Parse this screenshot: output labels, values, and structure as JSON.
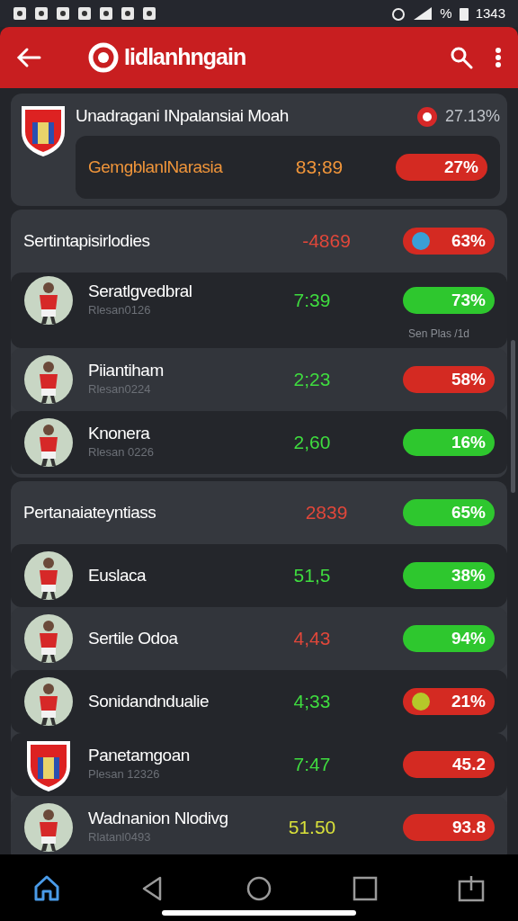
{
  "status_bar": {
    "battery_text": "%",
    "time": "1343"
  },
  "app_bar": {
    "title": "Iidlanhngain"
  },
  "match": {
    "title": "Unadragani INpalansiai Moah",
    "percent": "27.13%",
    "row": {
      "name": "GemgblanlNarasia",
      "value": "83;89",
      "color": "#f0953a",
      "pill": {
        "text": "27%",
        "color": "#d42a22"
      }
    }
  },
  "rows": [
    {
      "kind": "section",
      "name": "Sertintapisirlodies",
      "value": "-4869",
      "color": "#e0473a",
      "pill": {
        "text": "63%",
        "color": "#d42a22",
        "dot": {
          "color": "#3a9fd6"
        }
      }
    },
    {
      "kind": "player",
      "raised": true,
      "avatar": {
        "kind": "player"
      },
      "name": "Seratlgvedbral",
      "subtitle": "Rlesan0126",
      "value": "7:39",
      "color": "#3fdc3f",
      "pill": {
        "text": "73%",
        "color": "#2ec72e"
      },
      "caption": "Sen Plas /1d"
    },
    {
      "kind": "player",
      "raised": false,
      "avatar": {
        "kind": "player"
      },
      "name": "Piiantiham",
      "subtitle": "Rlesan0224",
      "value": "2;23",
      "color": "#3fdc3f",
      "pill": {
        "text": "58%",
        "color": "#d42a22"
      }
    },
    {
      "kind": "player",
      "raised": true,
      "avatar": {
        "kind": "player"
      },
      "name": "Knonera",
      "subtitle": "Rlesan 0226",
      "value": "2,60",
      "color": "#3fdc3f",
      "pill": {
        "text": "16%",
        "color": "#2ec72e"
      }
    },
    {
      "kind": "section",
      "name": "Pertanaiateyntiass",
      "value": "2839",
      "color": "#e0473a",
      "pill": {
        "text": "65%",
        "color": "#2ec72e"
      }
    },
    {
      "kind": "player",
      "raised": true,
      "avatar": {
        "kind": "player"
      },
      "name": "Euslaca",
      "value": "51,5",
      "color": "#3fdc3f",
      "pill": {
        "text": "38%",
        "color": "#2ec72e"
      }
    },
    {
      "kind": "player",
      "raised": false,
      "avatar": {
        "kind": "player"
      },
      "name": "Sertile Odoa",
      "value": "4,43",
      "color": "#e0473a",
      "pill": {
        "text": "94%",
        "color": "#2ec72e"
      }
    },
    {
      "kind": "player",
      "raised": true,
      "avatar": {
        "kind": "player"
      },
      "name": "Sonidandndualie",
      "value": "4;33",
      "color": "#3fdc3f",
      "pill": {
        "text": "21%",
        "color": "#d42a22",
        "dot": {
          "color": "#b5c82a"
        }
      }
    },
    {
      "kind": "player",
      "raised": true,
      "avatar": {
        "kind": "crest"
      },
      "name": "Panetamgoan",
      "subtitle": "Plesan 12326",
      "value": "7:47",
      "color": "#3fdc3f",
      "pill": {
        "text": "45.2",
        "color": "#d42a22"
      }
    },
    {
      "kind": "player",
      "raised": false,
      "avatar": {
        "kind": "player"
      },
      "name": "Wadnanion Nlodivg",
      "subtitle": "Rlatanl0493",
      "value": "51.50",
      "color": "#d8e03a",
      "pill": {
        "text": "93.8",
        "color": "#d42a22"
      }
    }
  ],
  "bottom_nav": [
    {
      "kind": "home",
      "selected": true
    },
    {
      "kind": "back",
      "selected": false
    },
    {
      "kind": "circle",
      "selected": false
    },
    {
      "kind": "square",
      "selected": false
    },
    {
      "kind": "share",
      "selected": false
    }
  ]
}
